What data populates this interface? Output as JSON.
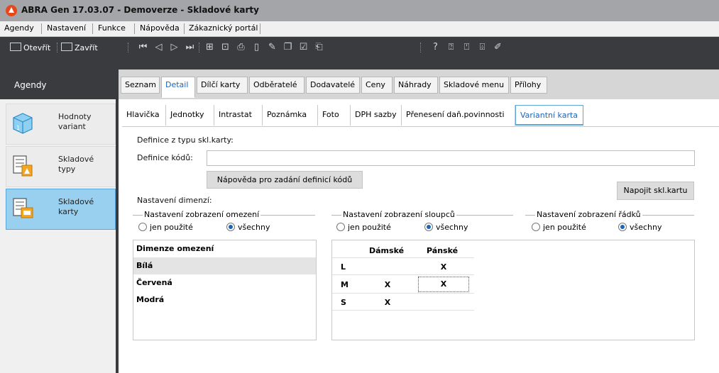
{
  "window": {
    "title": "ABRA Gen 17.03.07 - Demoverze - Skladové karty"
  },
  "menu": [
    "Agendy",
    "Nastavení",
    "Funkce",
    "Nápověda",
    "Zákaznický portál"
  ],
  "toolbar": {
    "open_label": "Otevřít",
    "close_label": "Zavřít"
  },
  "agenda": {
    "header": "Agendy",
    "items": [
      {
        "label": "Hodnoty\nvariant",
        "icon": "cube-icon"
      },
      {
        "label": "Skladové\ntypy",
        "icon": "stock-types-icon"
      },
      {
        "label": "Skladové\nkarty",
        "icon": "stock-cards-icon",
        "active": true
      }
    ]
  },
  "main_tabs": [
    "Seznam",
    "Detail",
    "Dílčí karty",
    "Odběratelé",
    "Dodavatelé",
    "Ceny",
    "Náhrady",
    "Skladové menu",
    "Přílohy"
  ],
  "sub_tabs": [
    "Hlavička",
    "Jednotky",
    "Intrastat",
    "Poznámka",
    "Foto",
    "DPH sazby",
    "Přenesení daň.povinnosti",
    "Variantní karta"
  ],
  "content": {
    "type_definitions_label": "Definice z typu skl.karty:",
    "code_definitions_label": "Definice kódů:",
    "code_definitions_value": "",
    "help_button": "Nápověda pro zadání definicí kódů",
    "link_button": "Napojit skl.kartu",
    "dimension_settings_label": "Nastavení dimenzí:",
    "groups": [
      {
        "title": "Nastavení zobrazení omezení",
        "opt_used": "jen použité",
        "opt_all": "všechny",
        "selected": "všechny"
      },
      {
        "title": "Nastavení zobrazení sloupců",
        "opt_used": "jen použité",
        "opt_all": "všechny",
        "selected": "všechny"
      },
      {
        "title": "Nastavení zobrazení řádků",
        "opt_used": "jen použité",
        "opt_all": "všechny",
        "selected": "všechny"
      }
    ],
    "dimension_table": {
      "header": "Dimenze omezení",
      "rows": [
        "Bílá",
        "Červená",
        "Modrá"
      ],
      "selected_row": "Bílá"
    },
    "variant_grid": {
      "columns": [
        "Dámské",
        "Pánské"
      ],
      "rows": [
        {
          "label": "L",
          "cells": [
            "",
            "X"
          ]
        },
        {
          "label": "M",
          "cells": [
            "X",
            "X"
          ]
        },
        {
          "label": "S",
          "cells": [
            "X",
            ""
          ]
        }
      ]
    }
  }
}
